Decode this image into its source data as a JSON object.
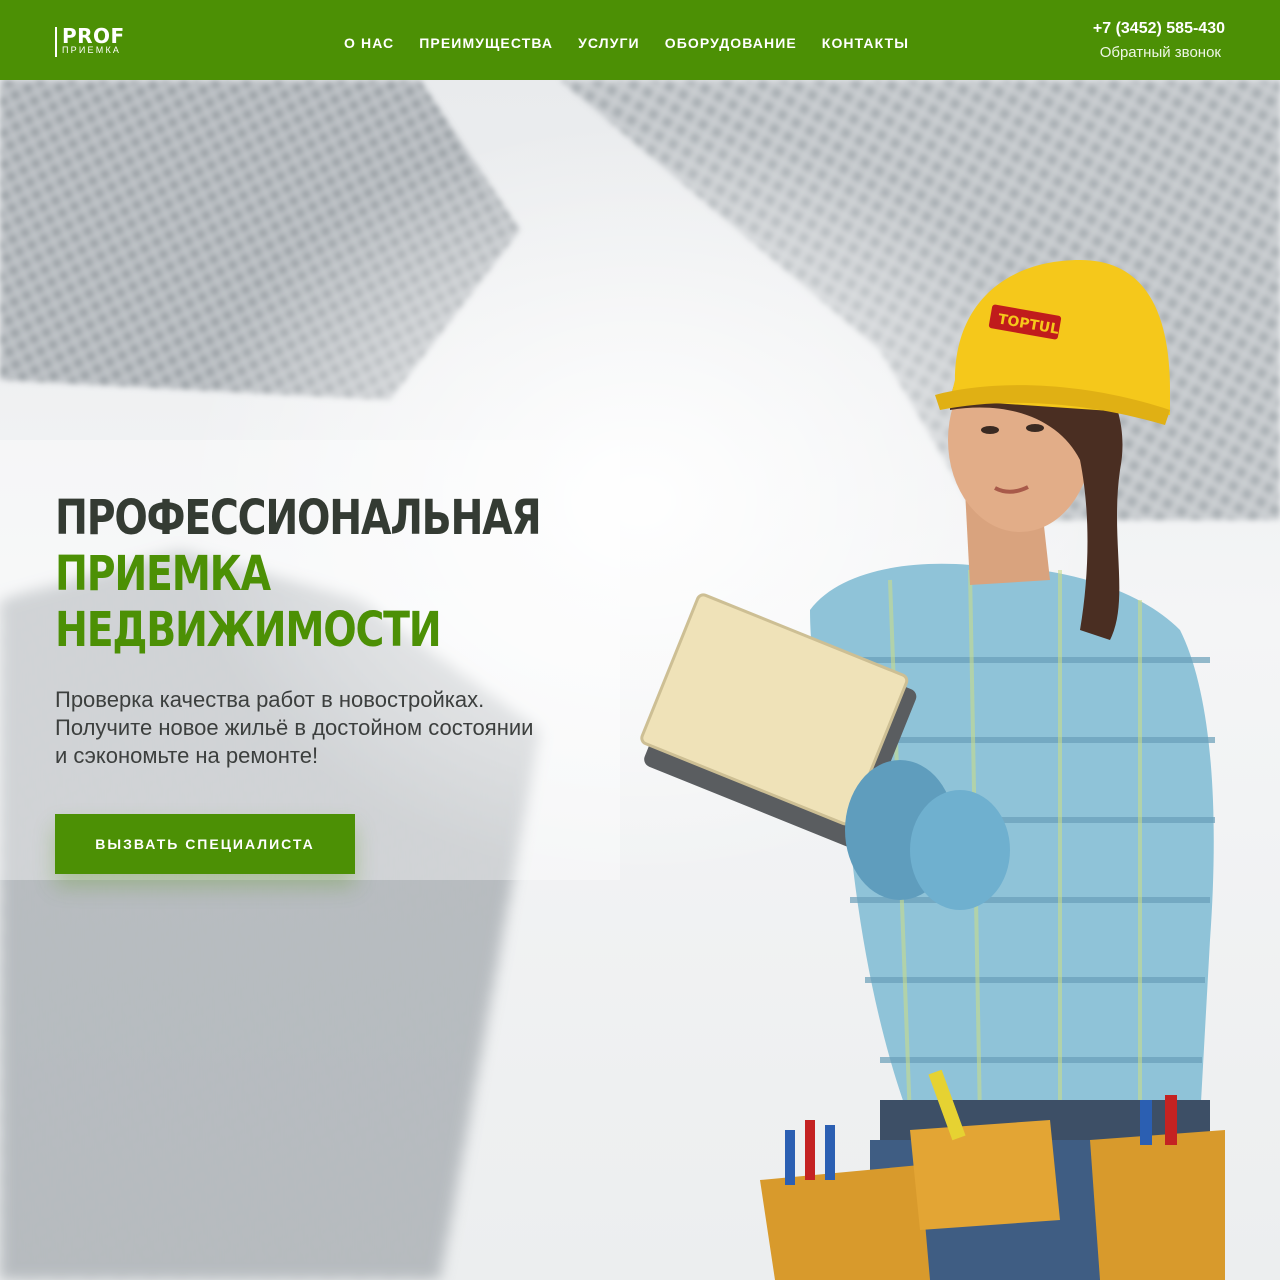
{
  "colors": {
    "brand_green": "#4c9005",
    "headline_dark": "#343b33",
    "text": "#3c3f3e",
    "header_text": "#ffffff"
  },
  "header": {
    "logo": {
      "top": "PROF",
      "bottom": "ПРИЕМКА"
    },
    "nav": [
      {
        "label": "О НАС"
      },
      {
        "label": "ПРЕИМУЩЕСТВА"
      },
      {
        "label": "УСЛУГИ"
      },
      {
        "label": "ОБОРУДОВАНИЕ"
      },
      {
        "label": "КОНТАКТЫ"
      }
    ],
    "phone": "+7 (3452) 585-430",
    "callback": "Обратный звонок"
  },
  "hero": {
    "headline": {
      "line1": "ПРОФЕССИОНАЛЬНАЯ",
      "line2": "ПРИЕМКА",
      "line3": "НЕДВИЖИМОСТИ"
    },
    "subtitle": {
      "line1": "Проверка качества работ в новостройках.",
      "line2": "Получите новое жильё в достойном состоянии",
      "line3": "и сэкономьте на ремонте!"
    },
    "cta": "ВЫЗВАТЬ СПЕЦИАЛИСТА",
    "helmet_brand": "TOPTUL",
    "background_image": "skyscrapers-background",
    "hero_image": "construction-worker-woman"
  }
}
